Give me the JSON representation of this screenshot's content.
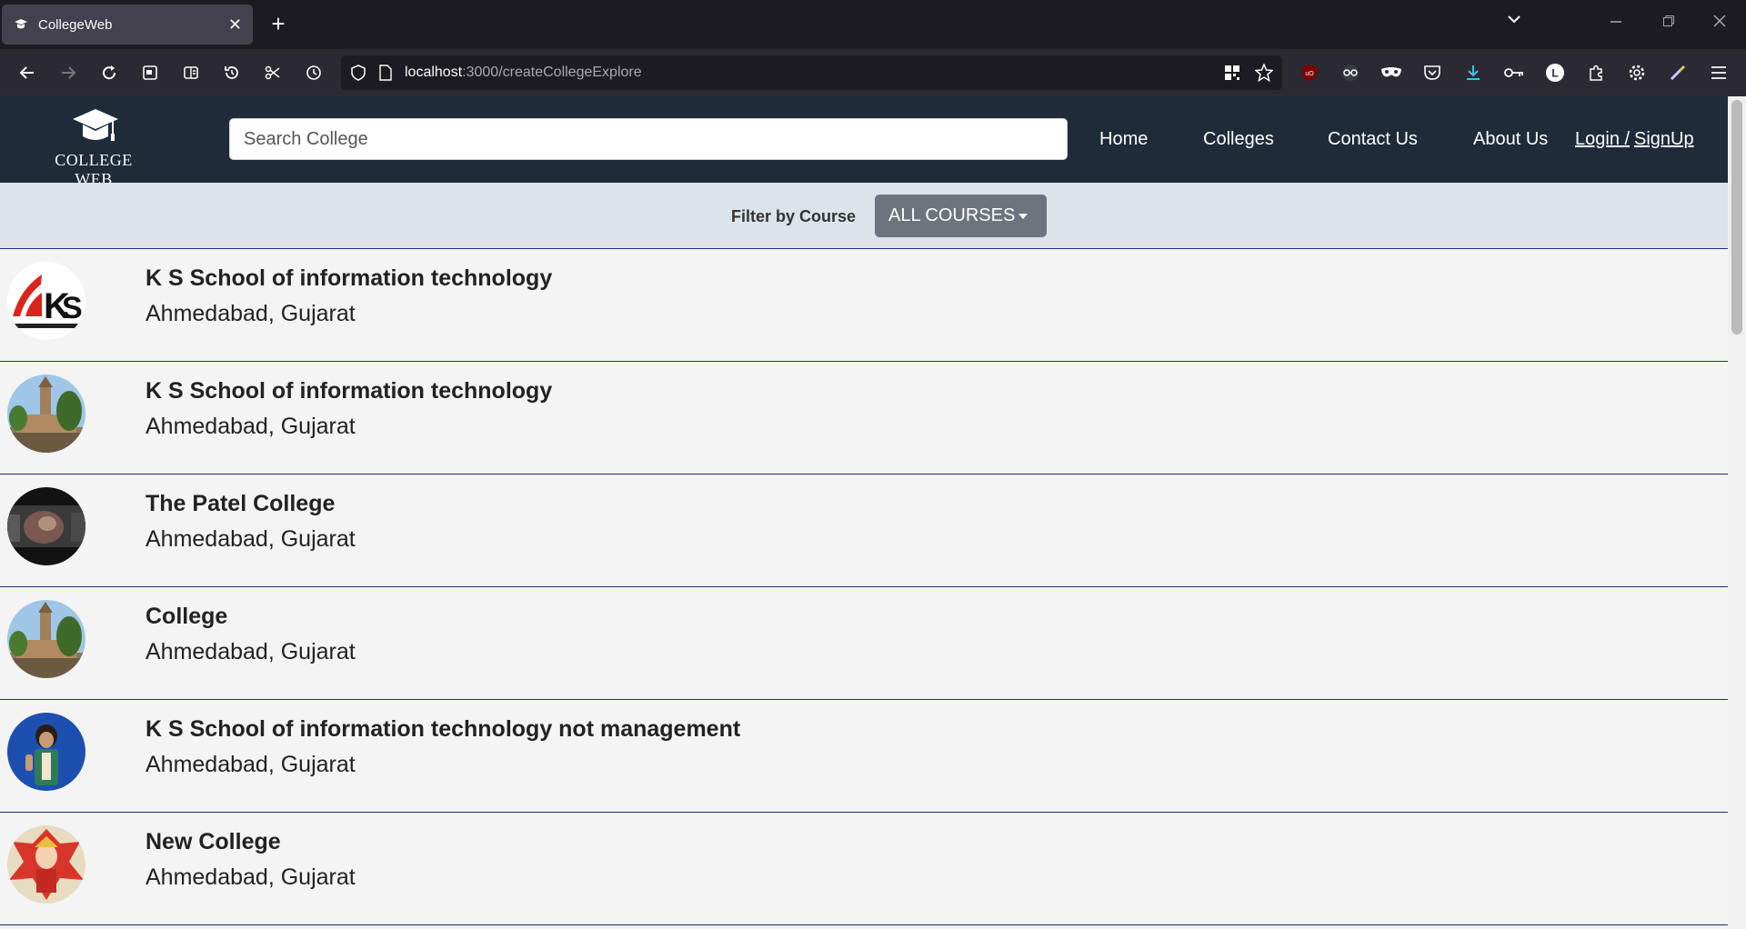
{
  "browser": {
    "tab_title": "CollegeWeb",
    "tab_close": "✕",
    "new_tab": "+",
    "url_host": "localhost",
    "url_path": ":3000/createCollegeExplore"
  },
  "site": {
    "logo_text": "COLLEGE WEB",
    "search_placeholder": "Search College",
    "nav": {
      "home": "Home",
      "colleges": "Colleges",
      "contact": "Contact Us",
      "about": "About Us",
      "login": "Login /",
      "signup": "SignUp"
    },
    "filter": {
      "label": "Filter by Course",
      "button": "ALL COURSES"
    },
    "colleges": [
      {
        "name": "K S School of information technology",
        "location": "Ahmedabad, Gujarat",
        "image": "ks-logo"
      },
      {
        "name": "K S School of information technology",
        "location": "Ahmedabad, Gujarat",
        "image": "tower-building"
      },
      {
        "name": "The Patel College",
        "location": "Ahmedabad, Gujarat",
        "image": "dark-photo"
      },
      {
        "name": "College",
        "location": "Ahmedabad, Gujarat",
        "image": "tower-building"
      },
      {
        "name": "K S School of information technology not management",
        "location": "Ahmedabad, Gujarat",
        "image": "person-blue"
      },
      {
        "name": "New College",
        "location": "Ahmedabad, Gujarat",
        "image": "anime-character"
      }
    ]
  },
  "colors": {
    "navbar": "#1f2b38",
    "filterbar": "#dce3eb",
    "row_divider": "#1b2e7a",
    "filter_button": "#6c757d"
  }
}
